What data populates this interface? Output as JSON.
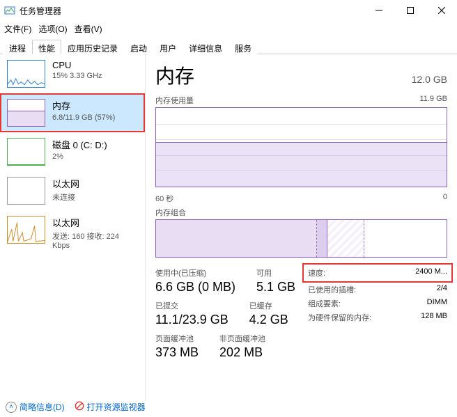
{
  "window": {
    "title": "任务管理器"
  },
  "menu": {
    "file": "文件(F)",
    "options": "选项(O)",
    "view": "查看(V)"
  },
  "tabs": [
    "进程",
    "性能",
    "应用历史记录",
    "启动",
    "用户",
    "详细信息",
    "服务"
  ],
  "active_tab": 1,
  "sidebar": {
    "items": [
      {
        "title": "CPU",
        "sub": "15% 3.33 GHz",
        "kind": "cpu"
      },
      {
        "title": "内存",
        "sub": "6.8/11.9 GB (57%)",
        "kind": "mem",
        "selected": true,
        "highlight": true
      },
      {
        "title": "磁盘 0 (C: D:)",
        "sub": "2%",
        "kind": "disk"
      },
      {
        "title": "以太网",
        "sub": "未连接",
        "kind": "net"
      },
      {
        "title": "以太网",
        "sub": "发送: 160 接收: 224 Kbps",
        "kind": "net2"
      }
    ]
  },
  "main": {
    "title": "内存",
    "total": "12.0 GB",
    "usage_label": "内存使用量",
    "usage_max": "11.9 GB",
    "time_left": "60 秒",
    "time_right": "0",
    "comp_label": "内存组合",
    "stats_left": [
      {
        "label": "使用中(已压缩)",
        "value": "6.6 GB (0 MB)",
        "label2": "可用",
        "value2": "5.1 GB"
      },
      {
        "label": "已提交",
        "value": "11.1/23.9 GB",
        "label2": "已缓存",
        "value2": "4.2 GB"
      },
      {
        "label": "页面缓冲池",
        "value": "373 MB",
        "label2": "非页面缓冲池",
        "value2": "202 MB"
      }
    ],
    "stats_right": [
      {
        "k": "速度:",
        "v": "2400 M...",
        "highlight": true
      },
      {
        "k": "已使用的插槽:",
        "v": "2/4"
      },
      {
        "k": "组成要素:",
        "v": "DIMM"
      },
      {
        "k": "为硬件保留的内存:",
        "v": "128 MB"
      }
    ]
  },
  "footer": {
    "fewer": "简略信息(D)",
    "resmon": "打开资源监视器"
  },
  "chart_data": {
    "type": "area",
    "title": "内存使用量",
    "ylim": [
      0,
      11.9
    ],
    "ylabel": "GB",
    "x_range_seconds": 60,
    "series": [
      {
        "name": "内存",
        "approx_constant_value": 6.8
      }
    ]
  }
}
